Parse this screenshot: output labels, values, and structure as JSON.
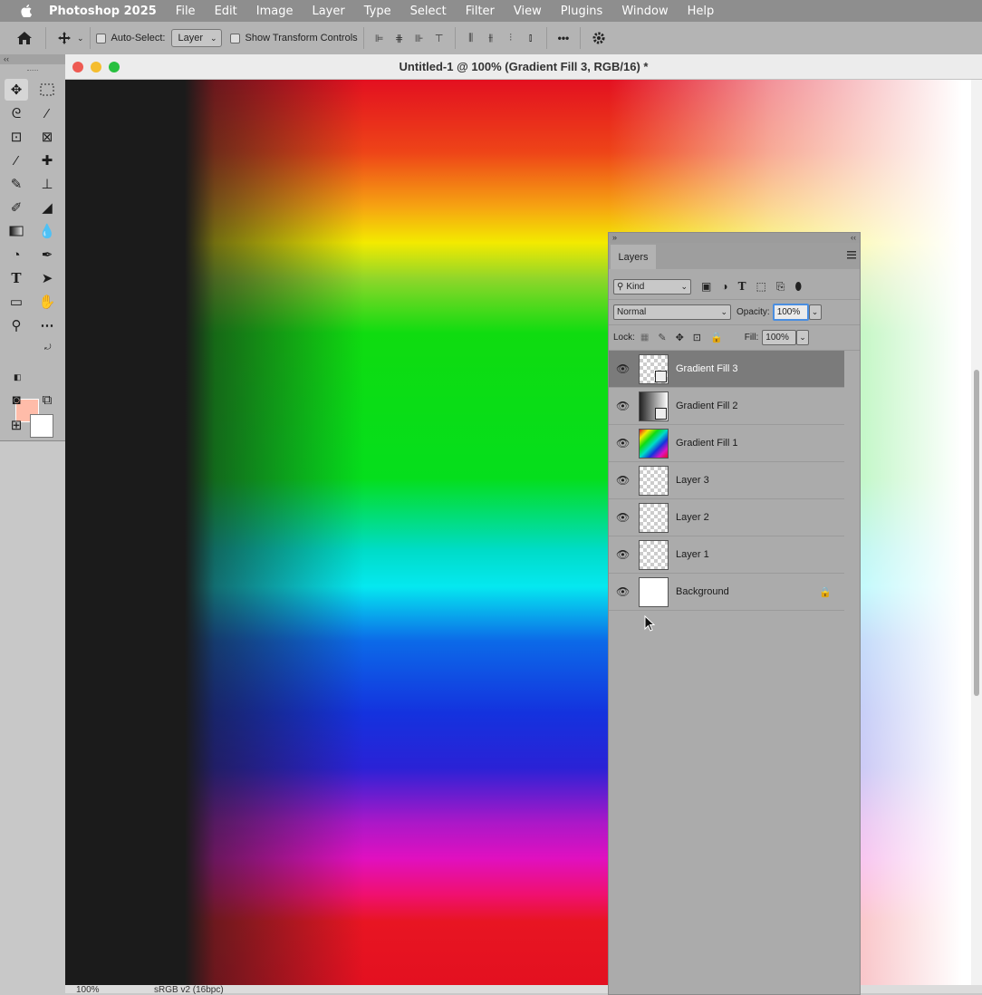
{
  "menubar": {
    "app_name": "Photoshop 2025",
    "menus": [
      "File",
      "Edit",
      "Image",
      "Layer",
      "Type",
      "Select",
      "Filter",
      "View",
      "Plugins",
      "Window",
      "Help"
    ]
  },
  "options_bar": {
    "auto_select_label": "Auto-Select:",
    "auto_select_value": "Layer",
    "show_transform_label": "Show Transform Controls",
    "more_label": "•••"
  },
  "toolbar": {
    "collapse_label": "‹‹",
    "foreground_color": "#ffbca9",
    "background_color": "#ffffff"
  },
  "document": {
    "title": "Untitled-1 @ 100% (Gradient Fill 3, RGB/16) *",
    "zoom": "100%",
    "color_mode": "sRGB v2 (16bpc)"
  },
  "layers_panel": {
    "collapse_label": "»",
    "collapse_right_label": "‹‹",
    "tab_label": "Layers",
    "filter_kind": "Kind",
    "blend_mode": "Normal",
    "opacity_label": "Opacity:",
    "opacity_value": "100%",
    "lock_label": "Lock:",
    "fill_label": "Fill:",
    "fill_value": "100%",
    "layers": [
      {
        "name": "Gradient Fill 3",
        "selected": true
      },
      {
        "name": "Gradient Fill 2",
        "selected": false
      },
      {
        "name": "Gradient Fill 1",
        "selected": false
      },
      {
        "name": "Layer 3",
        "selected": false
      },
      {
        "name": "Layer 2",
        "selected": false
      },
      {
        "name": "Layer 1",
        "selected": false
      },
      {
        "name": "Background",
        "selected": false,
        "locked": true
      }
    ]
  }
}
